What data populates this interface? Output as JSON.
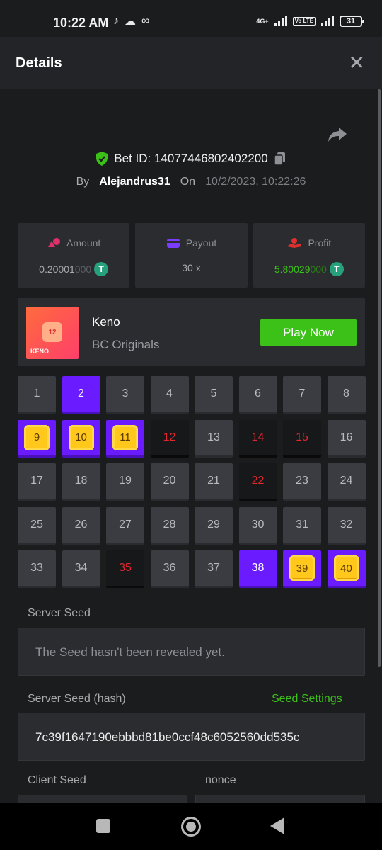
{
  "status_bar": {
    "time": "10:22 AM",
    "icons": [
      "tiktok-icon",
      "cloud-icon",
      "voicemail-icon"
    ],
    "network": "4G+",
    "volte": "Vo LTE",
    "battery": "31"
  },
  "header": {
    "title": "Details",
    "close_icon": "close-icon"
  },
  "bet": {
    "id_label": "Bet ID: 14077446802402200",
    "by_label": "By",
    "user": "Alejandrus31",
    "on_label": "On",
    "date": "10/2/2023, 10:22:26"
  },
  "stats": [
    {
      "label": "Amount",
      "icon": "coins-icon",
      "value_main": "0.20001",
      "value_dim": "000",
      "currency": "T",
      "color": "#e0306a"
    },
    {
      "label": "Payout",
      "icon": "wallet-icon",
      "value_main": "30 x",
      "value_dim": "",
      "currency": "",
      "color": "#7a3cff"
    },
    {
      "label": "Profit",
      "icon": "hand-coin-icon",
      "value_main": "5.80029",
      "value_dim": "000",
      "currency": "T",
      "color": "#e0302e"
    }
  ],
  "game": {
    "name": "Keno",
    "provider": "BC Originals",
    "thumb_number": "12",
    "thumb_label": "KENO",
    "play_label": "Play Now"
  },
  "keno": {
    "numbers": [
      "1",
      "2",
      "3",
      "4",
      "5",
      "6",
      "7",
      "8",
      "9",
      "10",
      "11",
      "12",
      "13",
      "14",
      "15",
      "16",
      "17",
      "18",
      "19",
      "20",
      "21",
      "22",
      "23",
      "24",
      "25",
      "26",
      "27",
      "28",
      "29",
      "30",
      "31",
      "32",
      "33",
      "34",
      "35",
      "36",
      "37",
      "38",
      "39",
      "40"
    ],
    "picked": [
      "2",
      "38"
    ],
    "hits": [
      "9",
      "10",
      "11",
      "39",
      "40"
    ],
    "misses": [
      "12",
      "14",
      "15",
      "22",
      "35"
    ]
  },
  "seeds": {
    "server_label": "Server Seed",
    "server_value": "The Seed hasn't been revealed yet.",
    "hash_label": "Server Seed (hash)",
    "settings_label": "Seed Settings",
    "hash_value": "7c39f1647190ebbbd81be0ccf48c6052560dd535c",
    "client_label": "Client Seed",
    "nonce_label": "nonce"
  },
  "colors": {
    "accent_green": "#3bc117",
    "picked_purple": "#6a1bff",
    "gem_gold": "#ffc81a",
    "miss_red": "#e0262e"
  }
}
